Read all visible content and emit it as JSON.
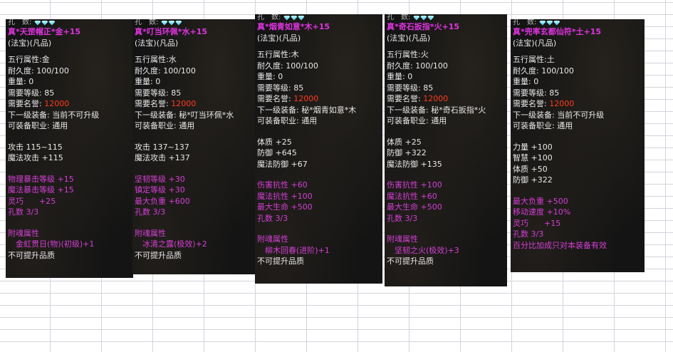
{
  "colors": {
    "title": "#e033e0",
    "attr": "#d43fd4",
    "reputation": "#ff3b1a"
  },
  "panels": [
    {
      "head": "孔　数:",
      "title": "真*天罡帽正*金+15",
      "type": "(法宝)(凡品)",
      "element": "五行属性:金",
      "durability": "耐久度: 100/100",
      "weight": "重量: 0",
      "level": "需要等级: 85",
      "reputation_label": "需要名誉: ",
      "reputation_value": "12000",
      "next": "下一级装备: 当前不可升级",
      "job": "可装备职业: 通用",
      "stats": [
        "攻击 115~115",
        "魔法攻击 +115"
      ],
      "attrs": [
        "物理暴击等级 +15",
        "魔法暴击等级 +15",
        "灵巧　　+25",
        "孔数 3/3"
      ],
      "soul_title": "附魂属性",
      "soul": "　金虹贯日(物)(初级)+1",
      "footer": "不可提升品质"
    },
    {
      "head": "孔　数:",
      "title": "真*叮当环佩*水+15",
      "type": "(法宝)(凡品)",
      "element": "五行属性:水",
      "durability": "耐久度: 100/100",
      "weight": "重量: 0",
      "level": "需要等级: 85",
      "reputation_label": "需要名誉: ",
      "reputation_value": "12000",
      "next": "下一级装备: 秘*叮当环佩*水",
      "job": "可装备职业: 通用",
      "stats": [
        "攻击 137~137",
        "魔法攻击 +137"
      ],
      "attrs": [
        "坚韧等级 +30",
        "镇定等级 +30",
        "最大负重 +600",
        "孔数 3/3"
      ],
      "soul_title": "附魂属性",
      "soul": "　冰清之露(极效)+2",
      "footer": "不可提升品质"
    },
    {
      "head": "孔　数:",
      "title": "真*烟青如意*木+15",
      "type": "(法宝)(凡品)",
      "element": "五行属性:木",
      "durability": "耐久度: 100/100",
      "weight": "重量: 0",
      "level": "需要等级: 85",
      "reputation_label": "需要名誉: ",
      "reputation_value": "12000",
      "next": "下一级装备: 秘*烟青如意*木",
      "job": "可装备职业: 通用",
      "stats": [
        "体质 +25",
        "防御 +645",
        "魔法防御 +67"
      ],
      "attrs": [
        "伤害抗性 +60",
        "魔法抗性 +100",
        "最大生命 +500",
        "孔数 3/3"
      ],
      "soul_title": "附魂属性",
      "soul": "　柳木回春(进阶)+1",
      "footer": "不可提升品质"
    },
    {
      "head": "孔　数:",
      "title": "真*奇石扳指*火+15",
      "type": "(法宝)(凡品)",
      "element": "五行属性:火",
      "durability": "耐久度: 100/100",
      "weight": "重量: 0",
      "level": "需要等级: 85",
      "reputation_label": "需要名誉: ",
      "reputation_value": "12000",
      "next": "下一级装备: 秘*奇石扳指*火",
      "job": "可装备职业: 通用",
      "stats": [
        "体质 +25",
        "防御 +322",
        "魔法防御 +135"
      ],
      "attrs": [
        "伤害抗性 +100",
        "魔法抗性 +60",
        "最大生命 +500",
        "孔数 3/3"
      ],
      "soul_title": "附魂属性",
      "soul": "　坚韧之火(极效)+3",
      "footer": "不可提升品质"
    },
    {
      "head": "孔　数:",
      "title": "真*兜率玄都仙符*土+15",
      "type": "(法宝)(凡品)",
      "element": "五行属性:土",
      "durability": "耐久度: 100/100",
      "weight": "重量: 0",
      "level": "需要等级: 85",
      "reputation_label": "需要名誉: ",
      "reputation_value": "12000",
      "next": "下一级装备: 当前不可升级",
      "job": "可装备职业: 通用",
      "stats": [
        "力量 +100",
        "智慧 +100",
        "体质 +50",
        "防御 +322"
      ],
      "attrs": [
        "最大负重 +500",
        "移动速度 +10%",
        "灵巧　　+15",
        "孔数 3/3"
      ],
      "soul_title": "",
      "soul": "",
      "footer": "百分比加成只对本装备有效"
    }
  ]
}
